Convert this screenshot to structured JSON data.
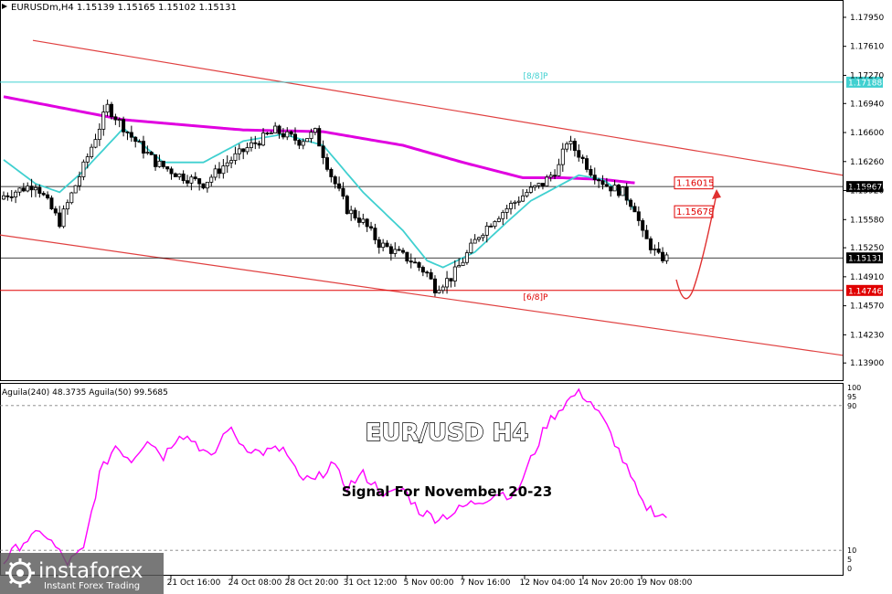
{
  "window": {
    "header": "EURUSDm,H4  1.15139 1.15165 1.15102 1.15131"
  },
  "overlay": {
    "title": "EUR/USD H4",
    "subtitle": "Signal For November 20-23"
  },
  "watermark": {
    "brand": "instaforex",
    "tagline": "Instant Forex Trading"
  },
  "colors": {
    "candle": "#000000",
    "bull_fill": "#ffffff",
    "bear_fill": "#000000",
    "ema_magenta": "#e000e0",
    "sma_cyan": "#40d0d0",
    "channel": "#e04040",
    "level_red": "#e00000",
    "level_cyan": "#40d0d0",
    "price_box": "#000000",
    "arrow": "#e03030",
    "aguila": "#ff00ff"
  },
  "chart_data": [
    {
      "type": "candlestick",
      "symbol": "EURUSDm",
      "timeframe": "H4",
      "ylim": [
        1.1372,
        1.1811
      ],
      "y_ticks": [
        "1.17950",
        "1.17610",
        "1.17270",
        "1.16940",
        "1.16600",
        "1.16260",
        "1.15920",
        "1.15580",
        "1.15250",
        "1.14910",
        "1.14570",
        "1.14230",
        "1.13900"
      ],
      "x_ticks": [
        "21 Oct 16:00",
        "24 Oct 08:00",
        "28 Oct 20:00",
        "31 Oct 12:00",
        "5 Nov 00:00",
        "7 Nov 16:00",
        "12 Nov 04:00",
        "14 Nov 20:00",
        "19 Nov 08:00"
      ],
      "close_anchors": [
        [
          0,
          1.1586
        ],
        [
          8,
          1.16
        ],
        [
          14,
          1.1555
        ],
        [
          20,
          1.162
        ],
        [
          26,
          1.169
        ],
        [
          32,
          1.1655
        ],
        [
          38,
          1.1625
        ],
        [
          44,
          1.161
        ],
        [
          50,
          1.16
        ],
        [
          56,
          1.1625
        ],
        [
          62,
          1.1645
        ],
        [
          68,
          1.1662
        ],
        [
          74,
          1.165
        ],
        [
          78,
          1.166
        ],
        [
          82,
          1.161
        ],
        [
          86,
          1.157
        ],
        [
          90,
          1.1555
        ],
        [
          94,
          1.153
        ],
        [
          98,
          1.152
        ],
        [
          102,
          1.151
        ],
        [
          106,
          1.1495
        ],
        [
          108,
          1.1478
        ],
        [
          112,
          1.149
        ],
        [
          115,
          1.151
        ],
        [
          119,
          1.154
        ],
        [
          123,
          1.156
        ],
        [
          127,
          1.1575
        ],
        [
          131,
          1.159
        ],
        [
          135,
          1.16
        ],
        [
          139,
          1.162
        ],
        [
          141,
          1.165
        ],
        [
          144,
          1.1635
        ],
        [
          147,
          1.1615
        ],
        [
          151,
          1.1598
        ],
        [
          155,
          1.159
        ],
        [
          158,
          1.1572
        ],
        [
          160,
          1.154
        ],
        [
          162,
          1.1527
        ],
        [
          164,
          1.1514
        ],
        [
          166,
          1.1513
        ]
      ],
      "ema_anchors": [
        [
          0,
          1.1702
        ],
        [
          30,
          1.1675
        ],
        [
          60,
          1.1663
        ],
        [
          80,
          1.1661
        ],
        [
          100,
          1.1645
        ],
        [
          115,
          1.1625
        ],
        [
          130,
          1.1607
        ],
        [
          140,
          1.1607
        ],
        [
          150,
          1.1605
        ],
        [
          158,
          1.1601
        ]
      ],
      "sma_anchors": [
        [
          0,
          1.1628
        ],
        [
          8,
          1.16
        ],
        [
          14,
          1.159
        ],
        [
          20,
          1.1615
        ],
        [
          30,
          1.1665
        ],
        [
          40,
          1.1625
        ],
        [
          50,
          1.1625
        ],
        [
          60,
          1.165
        ],
        [
          70,
          1.1658
        ],
        [
          80,
          1.1645
        ],
        [
          90,
          1.159
        ],
        [
          100,
          1.1545
        ],
        [
          106,
          1.151
        ],
        [
          110,
          1.1502
        ],
        [
          118,
          1.152
        ],
        [
          126,
          1.1555
        ],
        [
          132,
          1.158
        ],
        [
          138,
          1.1595
        ],
        [
          144,
          1.161
        ],
        [
          150,
          1.1605
        ],
        [
          156,
          1.1585
        ],
        [
          158,
          1.1567
        ]
      ],
      "channel_upper": [
        [
          1.1768,
          "start"
        ],
        [
          1.161,
          "end"
        ]
      ],
      "channel_lower": [
        [
          1.154,
          "start"
        ],
        [
          1.1399,
          "end"
        ]
      ],
      "levels": [
        {
          "label": "[8/8]P",
          "value": 1.1719,
          "price": "1.17188",
          "color": "cyan"
        },
        {
          "label": "",
          "value": 1.15967,
          "price": "1.15967",
          "color": "black"
        },
        {
          "label": "",
          "value": 1.15131,
          "price": "1.15131",
          "color": "black"
        },
        {
          "label": "[6/8]P",
          "value": 1.1475,
          "price": "1.14746",
          "color": "red"
        }
      ],
      "annotations": [
        {
          "text": "1.16015",
          "value": 1.16015
        },
        {
          "text": "1.15678",
          "value": 1.15678
        }
      ]
    },
    {
      "type": "line",
      "indicator": "Aguila(240) 48.3735  Aguila(50) 99.5685",
      "ylim": [
        0,
        100
      ],
      "y_ticks": [
        "100",
        "95",
        "90",
        "10",
        "5",
        "0"
      ],
      "levels": [
        90,
        10
      ],
      "anchors": [
        [
          0,
          4
        ],
        [
          5,
          15
        ],
        [
          10,
          20
        ],
        [
          16,
          3
        ],
        [
          20,
          10
        ],
        [
          24,
          52
        ],
        [
          28,
          68
        ],
        [
          32,
          60
        ],
        [
          36,
          72
        ],
        [
          40,
          62
        ],
        [
          44,
          75
        ],
        [
          48,
          70
        ],
        [
          52,
          60
        ],
        [
          56,
          78
        ],
        [
          60,
          68
        ],
        [
          64,
          64
        ],
        [
          70,
          66
        ],
        [
          74,
          50
        ],
        [
          78,
          48
        ],
        [
          82,
          58
        ],
        [
          86,
          45
        ],
        [
          90,
          52
        ],
        [
          96,
          40
        ],
        [
          100,
          44
        ],
        [
          104,
          32
        ],
        [
          108,
          28
        ],
        [
          112,
          30
        ],
        [
          116,
          35
        ],
        [
          120,
          38
        ],
        [
          124,
          42
        ],
        [
          128,
          40
        ],
        [
          132,
          60
        ],
        [
          136,
          80
        ],
        [
          140,
          90
        ],
        [
          144,
          98
        ],
        [
          147,
          92
        ],
        [
          150,
          82
        ],
        [
          153,
          70
        ],
        [
          156,
          55
        ],
        [
          158,
          45
        ],
        [
          160,
          35
        ],
        [
          162,
          33
        ],
        [
          164,
          30
        ],
        [
          166,
          29
        ]
      ]
    }
  ]
}
